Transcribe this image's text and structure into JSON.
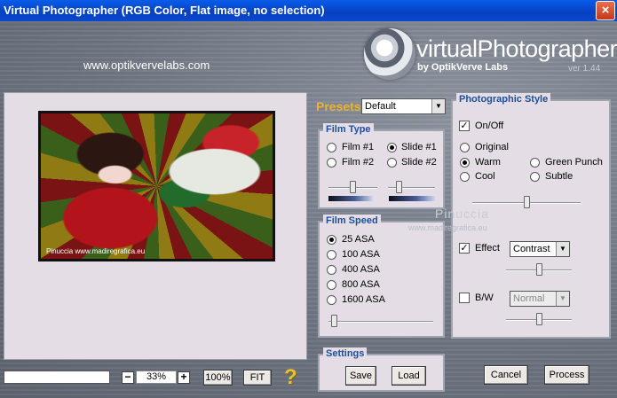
{
  "window": {
    "title": "Virtual Photographer (RGB Color, Flat image, no selection)",
    "close_glyph": "×"
  },
  "branding": {
    "website": "www.optikvervelabs.com",
    "name": "virtualPhotographer",
    "by": "by OptikVerve Labs",
    "version": "ver 1.44"
  },
  "preview": {
    "caption": "Pinuccia www.madiregrafica.eu"
  },
  "presets": {
    "label": "Presets",
    "value": "Default"
  },
  "film_type": {
    "title": "Film Type",
    "options": [
      {
        "label": "Film #1",
        "selected": false
      },
      {
        "label": "Slide #1",
        "selected": true
      },
      {
        "label": "Film #2",
        "selected": false
      },
      {
        "label": "Slide #2",
        "selected": false
      }
    ]
  },
  "film_speed": {
    "title": "Film Speed",
    "options": [
      {
        "label": "25 ASA",
        "selected": true
      },
      {
        "label": "100 ASA",
        "selected": false
      },
      {
        "label": "400 ASA",
        "selected": false
      },
      {
        "label": "800 ASA",
        "selected": false
      },
      {
        "label": "1600 ASA",
        "selected": false
      }
    ]
  },
  "settings": {
    "title": "Settings",
    "save": "Save",
    "load": "Load"
  },
  "photo_style": {
    "title": "Photographic Style",
    "onoff": {
      "label": "On/Off",
      "checked": true
    },
    "original": "Original",
    "warm": "Warm",
    "green_punch": "Green Punch",
    "cool": "Cool",
    "subtle": "Subtle",
    "selected": "Warm",
    "effect": {
      "label": "Effect",
      "checked": true,
      "value": "Contrast"
    },
    "bw": {
      "label": "B/W",
      "checked": false,
      "value": "Normal"
    }
  },
  "watermark": {
    "line1": "Pinuccia",
    "line2": "www.madiregrafica.eu"
  },
  "zoom": {
    "value": "33%",
    "minus": "−",
    "plus": "+",
    "btn_100": "100%",
    "btn_fit": "FIT"
  },
  "help": {
    "glyph": "?"
  },
  "actions": {
    "cancel": "Cancel",
    "process": "Process"
  },
  "colors": {
    "title_bar": "#0a5ce8",
    "panel_bg": "#e4dde6",
    "group_title": "#1d4f9a",
    "presets_label": "#e9b22f"
  }
}
